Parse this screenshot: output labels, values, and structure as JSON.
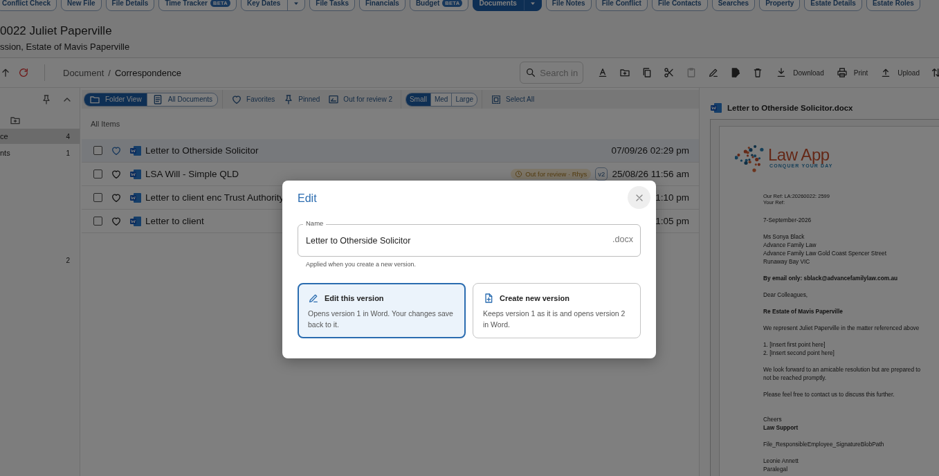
{
  "tabs": [
    {
      "label": "Conflict Check",
      "kind": "plain",
      "selected": false
    },
    {
      "label": "New File",
      "kind": "plain",
      "selected": false
    },
    {
      "label": "File Details",
      "kind": "plain",
      "selected": false
    },
    {
      "label": "Time Tracker",
      "badge": "BETA",
      "kind": "plain",
      "selected": false
    },
    {
      "label": "Key Dates",
      "kind": "split",
      "selected": false
    },
    {
      "label": "File Tasks",
      "kind": "plain",
      "selected": false
    },
    {
      "label": "Financials",
      "kind": "plain",
      "selected": false
    },
    {
      "label": "Budget",
      "badge": "BETA",
      "kind": "plain",
      "selected": false
    },
    {
      "label": "Documents",
      "kind": "split",
      "selected": true
    },
    {
      "label": "File Notes",
      "kind": "plain",
      "selected": false
    },
    {
      "label": "File Conflict",
      "kind": "plain",
      "selected": false
    },
    {
      "label": "File Contacts",
      "kind": "plain",
      "selected": false
    },
    {
      "label": "Searches",
      "kind": "plain",
      "selected": false
    },
    {
      "label": "Property",
      "kind": "plain",
      "selected": false
    },
    {
      "label": "Estate Details",
      "kind": "plain",
      "selected": false
    },
    {
      "label": "Estate Roles",
      "kind": "plain",
      "selected": false
    }
  ],
  "matter": {
    "title": "0022 Juliet Paperville",
    "subtitle": "ssion, Estate of Mavis Paperville"
  },
  "toolbar": {
    "breadcrumb": {
      "parent": "Document",
      "separator": "/",
      "current": "Correspondence"
    },
    "search": {
      "placeholder": "Search in"
    },
    "actions": [
      {
        "kind": "download",
        "label": "Download"
      },
      {
        "kind": "print",
        "label": "Print"
      },
      {
        "kind": "upload",
        "label": "Upload"
      }
    ]
  },
  "sidebar": {
    "items": [
      {
        "label": "ce",
        "count": "4",
        "selected": true
      },
      {
        "label": "nts",
        "count": "1",
        "selected": false
      }
    ],
    "other_items": [
      {
        "count": "2",
        "selected": false
      }
    ]
  },
  "filters": {
    "views": [
      {
        "kind": "folder",
        "label": "Folder View",
        "selected": true
      },
      {
        "kind": "list",
        "label": "All Documents",
        "selected": false
      }
    ],
    "quick": [
      {
        "kind": "favorites",
        "label": "Favorites"
      },
      {
        "kind": "pinned",
        "label": "Pinned"
      },
      {
        "kind": "review",
        "label": "Out for review 2"
      }
    ],
    "sizes": [
      {
        "label": "Small",
        "selected": true
      },
      {
        "label": "Med",
        "selected": false
      },
      {
        "label": "Large",
        "selected": false
      }
    ],
    "select_all": "Select All"
  },
  "list": {
    "heading": "All Items",
    "rows": [
      {
        "name": "Letter to Otherside Solicitor",
        "date": "07/09/26 02:29 pm",
        "selected": true,
        "checked": false
      },
      {
        "name": "LSA Will - Simple QLD",
        "status": "Out for review · Rhys",
        "version": "v2",
        "date": "25/08/26 11:56 am",
        "selected": false,
        "checked": false
      },
      {
        "name": "Letter to client enc Trust Authority",
        "date": "1:10 pm",
        "selected": false,
        "checked": false
      },
      {
        "name": "Letter to client",
        "date": "1:05 pm",
        "selected": false,
        "checked": false
      }
    ]
  },
  "preview": {
    "title": "Letter to Otherside Solicitor.docx",
    "logo": {
      "name": "Law App",
      "tagline": "CONQUER YOUR DAY"
    },
    "paragraphs": [
      {
        "kind": "ref",
        "text": "Our Ref: LA:20260022: 2599\nYour Ref:",
        "bold": false
      },
      {
        "kind": "body",
        "text": "7-September-2026",
        "bold": false
      },
      {
        "kind": "body",
        "text": "Ms Sonya Black\nAdvance Family Law\nAdvance Family Law Gold Coast Spencer Street\nRunaway Bay VIC",
        "bold": false
      },
      {
        "kind": "body",
        "text": "By email only: sblack@advancefamilylaw.com.au",
        "bold": true
      },
      {
        "kind": "body",
        "text": "Dear Colleagues,",
        "bold": false
      },
      {
        "kind": "body",
        "text": "Re Estate of Mavis Paperville",
        "bold": true
      },
      {
        "kind": "body",
        "text": "We represent Juliet Paperville in the matter referenced above",
        "bold": false
      },
      {
        "kind": "body",
        "text": "1. [Insert first point here]\n2. [Insert second point here]",
        "bold": false
      },
      {
        "kind": "body",
        "text": "We look forward to an amicable resolution but are prepared to\nnot be reached promptly.",
        "bold": false
      },
      {
        "kind": "body",
        "text": "Please feel free to contact us to discuss this further.",
        "bold": false
      },
      {
        "kind": "spaced",
        "text": "Cheers\n**Law Support**",
        "bold": false
      },
      {
        "kind": "body",
        "text": "File_ResponsibleEmployee_SignatureBlobPath",
        "bold": false
      },
      {
        "kind": "body",
        "text": "Leonie Annett\nParalegal",
        "bold": false
      }
    ]
  },
  "dialog": {
    "title": "Edit",
    "field": {
      "label": "Name",
      "value": "Letter to Otherside Solicitor",
      "suffix": ".docx",
      "helper": "Applied when you create a new version."
    },
    "options": [
      {
        "kind": "edit",
        "title": "Edit this version",
        "description": "Opens version 1 in Word. Your changes save back to it.",
        "selected": true
      },
      {
        "kind": "new",
        "title": "Create new version",
        "description": "Keeps version 1 as it is and opens version 2 in Word.",
        "selected": false
      }
    ]
  }
}
